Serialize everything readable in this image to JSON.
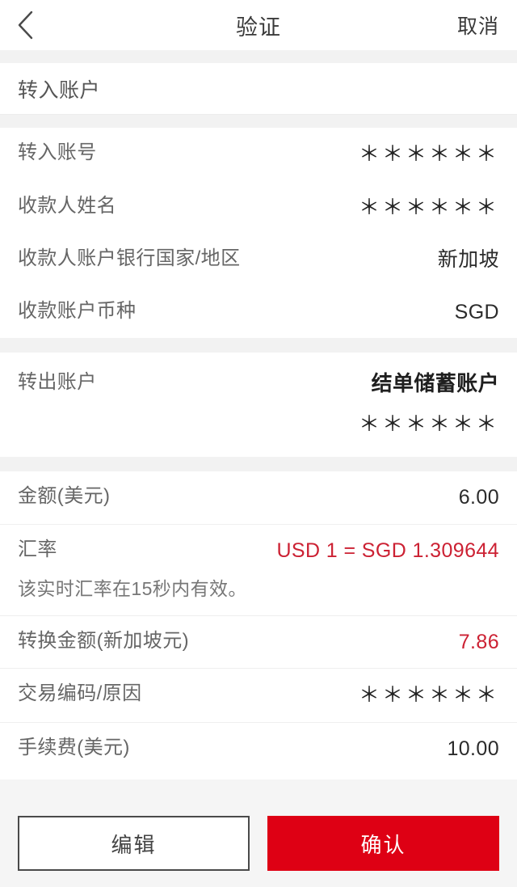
{
  "header": {
    "back_icon": "chevron-left-icon",
    "title": "验证",
    "cancel_label": "取消"
  },
  "payee_section": {
    "title": "转入账户",
    "rows": [
      {
        "label": "转入账号",
        "value": "＊＊＊＊＊＊",
        "style": "mask"
      },
      {
        "label": "收款人姓名",
        "value": "＊＊＊＊＊＊",
        "style": "mask"
      },
      {
        "label": "收款人账户银行国家/地区",
        "value": "新加坡",
        "style": "plain"
      },
      {
        "label": "收款账户币种",
        "value": "SGD",
        "style": "plain"
      }
    ]
  },
  "payer_section": {
    "label": "转出账户",
    "account_name": "结单储蓄账户",
    "account_number": "＊＊＊＊＊＊"
  },
  "details_section": {
    "amount": {
      "label": "金额(美元)",
      "value": "6.00"
    },
    "rate": {
      "label": "汇率",
      "value": "USD 1 = SGD 1.309644"
    },
    "rate_note": "该实时汇率在15秒内有效。",
    "converted": {
      "label": "转换金额(新加坡元)",
      "value": "7.86"
    },
    "purpose": {
      "label": "交易编码/原因",
      "value": "＊＊＊＊＊＊"
    },
    "fee": {
      "label": "手续费(美元)",
      "value": "10.00"
    }
  },
  "footer": {
    "edit_label": "编辑",
    "confirm_label": "确认"
  },
  "colors": {
    "brand_red": "#de0014",
    "rate_red": "#cc2133",
    "page_bg": "#f2f2f2",
    "card_bg": "#ffffff",
    "label_gray": "#666666"
  }
}
